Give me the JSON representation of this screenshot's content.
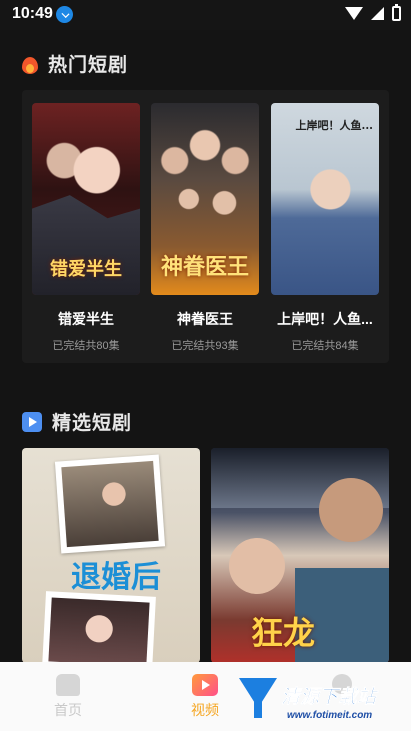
{
  "status_bar": {
    "time": "10:49"
  },
  "hot_section": {
    "title": "热门短剧",
    "items": [
      {
        "name": "错爱半生",
        "status": "已完结共80集",
        "poster_text": "错爱半生"
      },
      {
        "name": "神眷医王",
        "status": "已完结共93集",
        "poster_text": "神眷医王"
      },
      {
        "name": "上岸吧！人鱼...",
        "status": "已完结共84集",
        "poster_text": "上岸吧！人鱼..."
      }
    ]
  },
  "featured_section": {
    "title": "精选短剧",
    "items": [
      {
        "poster_text": "退婚后"
      },
      {
        "poster_text": "狂龙"
      }
    ]
  },
  "bottom_nav": {
    "items": [
      {
        "label": "首页"
      },
      {
        "label": "视频"
      },
      {
        "label": ""
      }
    ]
  },
  "watermark": {
    "text": "清源下载站",
    "url": "www.fotimeit.com"
  }
}
